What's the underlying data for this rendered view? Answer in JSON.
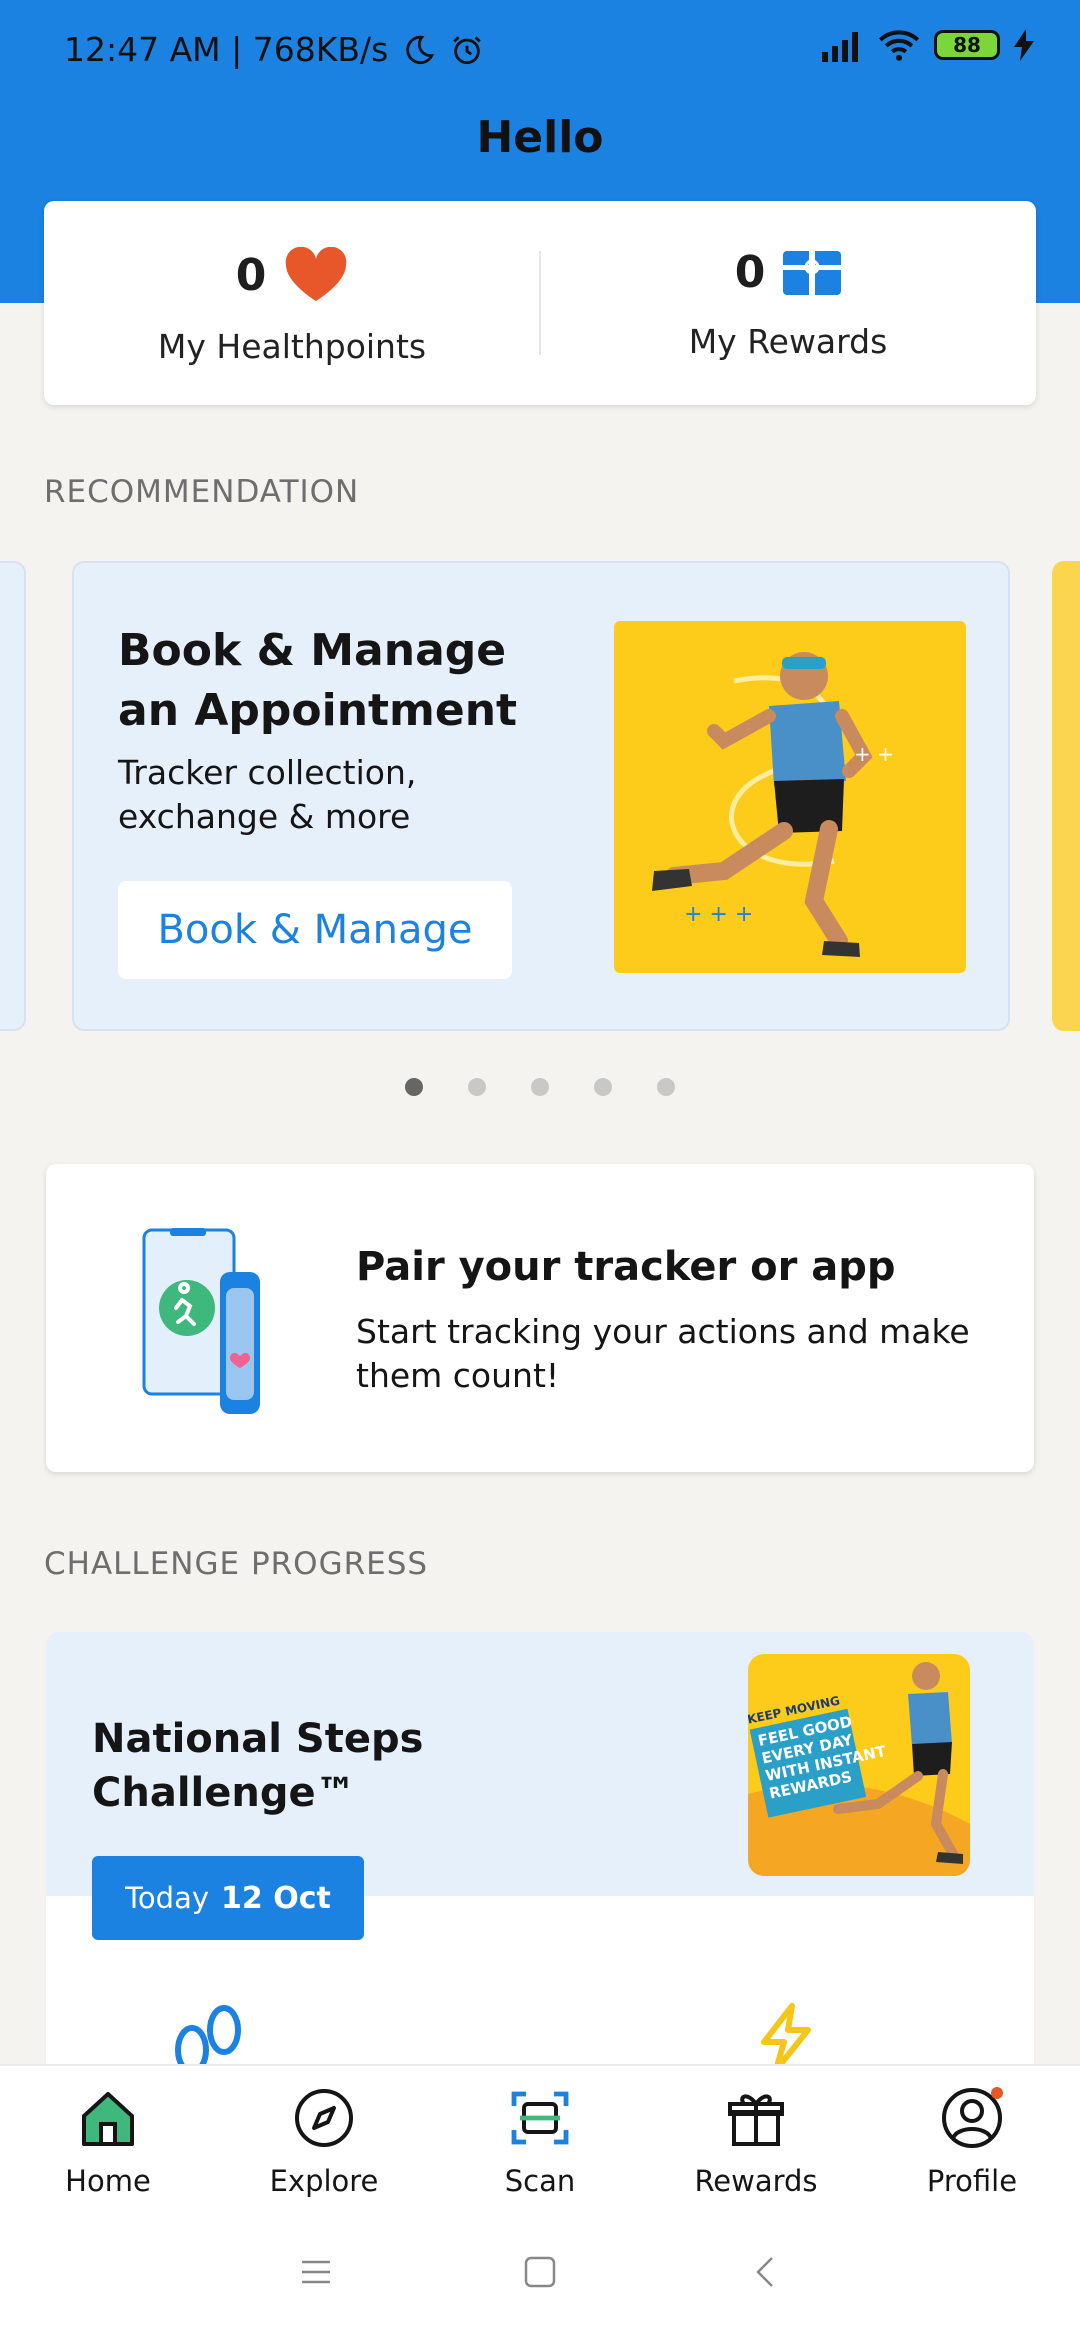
{
  "status_bar": {
    "time": "12:47 AM | 768KB/s",
    "battery": "88"
  },
  "header": {
    "title": "Hello"
  },
  "summary": {
    "healthpoints_value": "0",
    "healthpoints_label": "My Healthpoints",
    "rewards_value": "0",
    "rewards_label": "My Rewards"
  },
  "recommendation": {
    "section_label": "RECOMMENDATION",
    "card": {
      "title": "Book & Manage an Appointment",
      "subtitle": "Tracker collection, exchange & more",
      "button": "Book & Manage"
    },
    "page_count": 5,
    "active_page": 1
  },
  "pair": {
    "title": "Pair your tracker or app",
    "subtitle": "Start tracking your actions and make them count!"
  },
  "challenge": {
    "section_label": "CHALLENGE PROGRESS",
    "title": "National Steps Challenge™",
    "today_label": "Today",
    "today_date": "12 Oct",
    "promo_text": [
      "KEEP MOVING",
      "FEEL GOOD",
      "EVERY DAY",
      "WITH INSTANT",
      "REWARDS"
    ]
  },
  "bottom_nav": {
    "items": [
      {
        "label": "Home",
        "icon": "home-icon"
      },
      {
        "label": "Explore",
        "icon": "compass-icon"
      },
      {
        "label": "Scan",
        "icon": "scan-icon"
      },
      {
        "label": "Rewards",
        "icon": "gift-icon"
      },
      {
        "label": "Profile",
        "icon": "profile-icon"
      }
    ]
  },
  "colors": {
    "brand_blue": "#1b82e2",
    "heart": "#e8572a",
    "yellow": "#fdcc1b",
    "home_green": "#3fb87e"
  }
}
